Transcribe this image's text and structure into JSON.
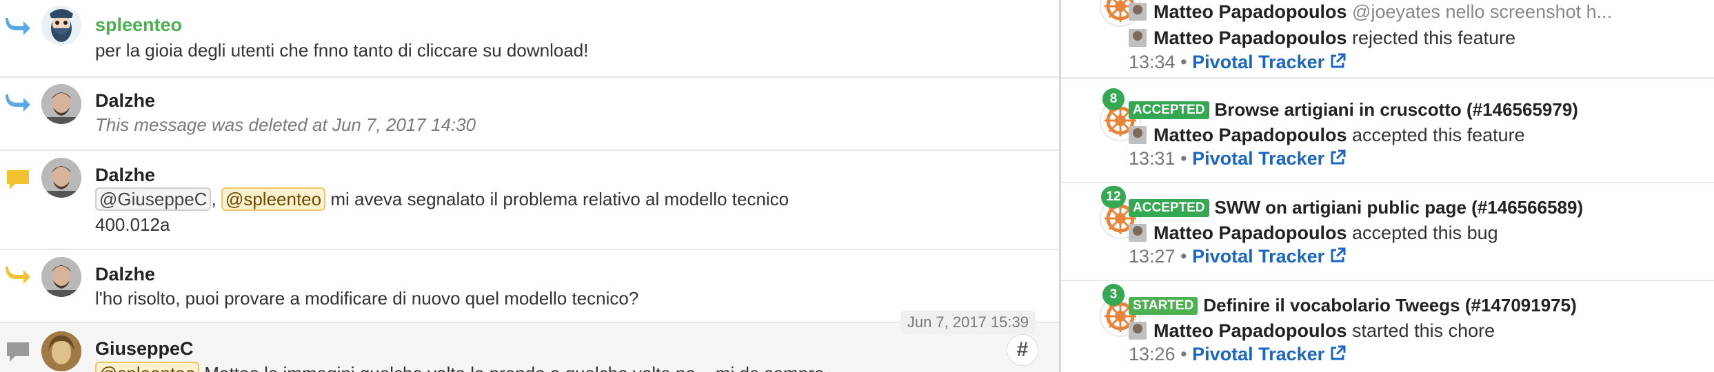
{
  "chat": {
    "messages": [
      {
        "author": "spleenteo",
        "text": "per la gioia degli utenti che fnno tanto di cliccare su download!"
      },
      {
        "author": "Dalzhe",
        "text": "This message was deleted at Jun 7, 2017 14:30"
      },
      {
        "author": "Dalzhe",
        "mention1": "@GiuseppeC",
        "sep": ",",
        "mention2": "@spleenteo",
        "text_a": "mi aveva segnalato il problema relativo al modello tecnico",
        "text_b": "400.012a"
      },
      {
        "author": "Dalzhe",
        "text": "l'ho risolto, puoi provare a modificare di nuovo quel modello tecnico?"
      },
      {
        "author": "GiuseppeC",
        "mention": "@spleenteo",
        "text": "Matteo le immagini qualche volta le prende e qualche volta no... mi da sempre"
      }
    ],
    "hover_timestamp": "Jun 7, 2017 15:39",
    "hash_label": "#"
  },
  "feed": {
    "items": [
      {
        "line1_user": "Matteo Papadopoulos",
        "line1_text": "@joeyates nello screenshot h...",
        "line2_user": "Matteo Papadopoulos",
        "line2_text": "rejected this feature",
        "time": "13:34",
        "source": "Pivotal Tracker"
      },
      {
        "count": "8",
        "badge": "ACCEPTED",
        "title": "Browse artigiani in cruscotto (#146565979)",
        "user": "Matteo Papadopoulos",
        "action": "accepted this feature",
        "time": "13:31",
        "source": "Pivotal Tracker"
      },
      {
        "count": "12",
        "badge": "ACCEPTED",
        "title": "SWW on artigiani public page (#146566589)",
        "user": "Matteo Papadopoulos",
        "action": "accepted this bug",
        "time": "13:27",
        "source": "Pivotal Tracker"
      },
      {
        "count": "3",
        "badge": "STARTED",
        "title": "Definire il vocabolario Tweegs (#147091975)",
        "user": "Matteo Papadopoulos",
        "action": "started this chore",
        "time": "13:26",
        "source": "Pivotal Tracker"
      }
    ],
    "dot": "•"
  },
  "colors": {
    "spleenteo_name": "#4caf50",
    "accepted": "#34a853",
    "started": "#4caf50",
    "link": "#1a66c2",
    "reply_blue": "#5aa9e6",
    "reply_yellow": "#f2c230",
    "pivotal_orange": "#e8843a"
  },
  "icons": {
    "reply": "reply-arrow-icon",
    "comment": "speech-bubble-icon",
    "external": "external-link-icon",
    "pivotal": "pivotal-tracker-logo"
  }
}
